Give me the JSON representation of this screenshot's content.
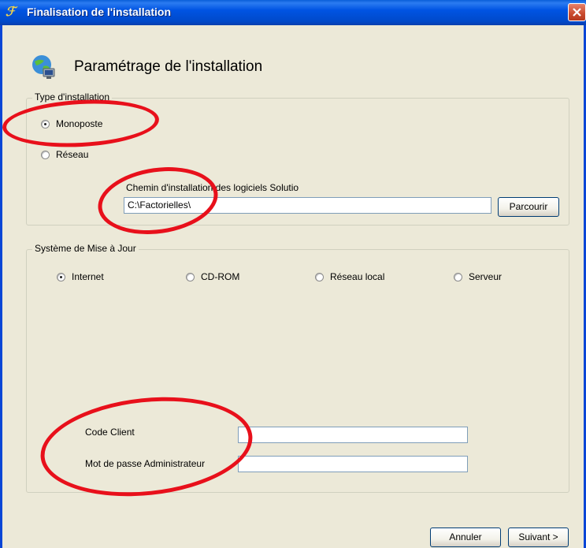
{
  "window": {
    "title": "Finalisation de l'installation",
    "header_title": "Paramétrage de l'installation"
  },
  "install_type": {
    "group_label": "Type d'installation",
    "options": [
      {
        "label": "Monoposte",
        "checked": true
      },
      {
        "label": "Réseau",
        "checked": false
      }
    ],
    "path_label": "Chemin d'installation des logiciels Solutio",
    "path_value": "C:\\Factorielles\\",
    "browse_label": "Parcourir"
  },
  "update_system": {
    "group_label": "Système de Mise à Jour",
    "options": [
      {
        "label": "Internet",
        "checked": true
      },
      {
        "label": "CD-ROM",
        "checked": false
      },
      {
        "label": "Réseau local",
        "checked": false
      },
      {
        "label": "Serveur",
        "checked": false
      }
    ],
    "client_code_label": "Code Client",
    "client_code_value": "",
    "admin_password_label": "Mot de passe Administrateur",
    "admin_password_value": ""
  },
  "footer": {
    "cancel_label": "Annuler",
    "next_label": "Suivant >"
  },
  "colors": {
    "titlebar": "#0054e3",
    "annotation": "#e8101b",
    "dialog_bg": "#ece9d8"
  }
}
